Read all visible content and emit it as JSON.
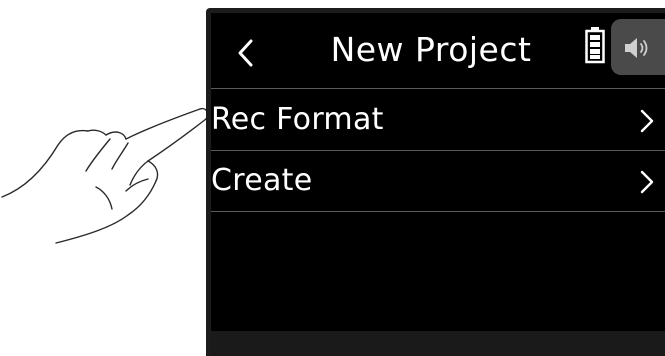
{
  "header": {
    "title": "New Project",
    "back_icon": "chevron-left-icon",
    "battery_icon": "battery-icon",
    "speaker_icon": "speaker-icon"
  },
  "menu": {
    "items": [
      {
        "label": "Rec Format",
        "icon": "chevron-right-icon"
      },
      {
        "label": "Create",
        "icon": "chevron-right-icon"
      }
    ]
  },
  "colors": {
    "screen_background": "#000000",
    "text": "#ffffff",
    "divider": "#5a5a5a",
    "speaker_tab": "#4a4a4a"
  }
}
